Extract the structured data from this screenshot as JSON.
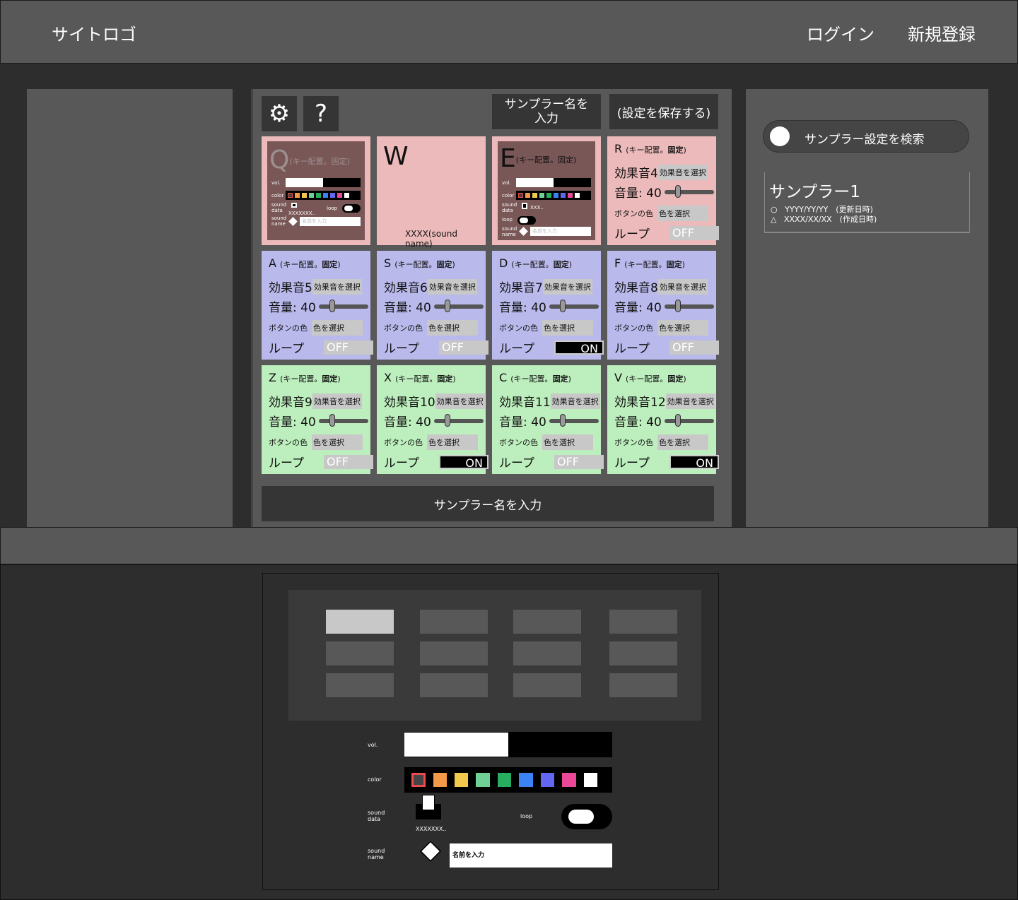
{
  "header": {
    "logo": "サイトロゴ",
    "login": "ログイン",
    "register": "新規登録"
  },
  "toolbar": {
    "settings_icon": "gear-icon",
    "help_label": "?",
    "name_input": "サンプラー名を\n入力",
    "save_label": "(設定を保存する)"
  },
  "pads_top": {
    "q": {
      "key": "Q",
      "note": "(キー配置。固定)",
      "vol": "vol.",
      "color": "color",
      "sound_data": "sound\ndata",
      "file": "XXXXXXX..",
      "loop": "loop",
      "sound_name": "sound\nname",
      "placeholder": "名前を入力"
    },
    "w": {
      "key": "W",
      "sound": "XXXX(sound name)"
    },
    "e": {
      "key": "E",
      "note": "(キー配置。固定)",
      "vol": "vol.",
      "color": "color",
      "sound_data": "sound\ndata",
      "file": "XXX..",
      "loop": "loop",
      "sound_name": "sound\nname",
      "placeholder": "名前を入力"
    }
  },
  "pads": [
    {
      "key": "R",
      "note": "(キー配置。",
      "bold": "固定",
      "close": ")",
      "sound": "効果音4",
      "choose": "効果音を選択",
      "volume": "音量: 40",
      "color_label": "ボタンの色",
      "color_choose": "色を選択",
      "loop_label": "ループ",
      "loop": "OFF",
      "on": false,
      "color": "pink",
      "volume_value": 40
    },
    {
      "key": "A",
      "note": "(キー配置。",
      "bold": "固定",
      "close": ")",
      "sound": "効果音5",
      "choose": "効果音を選択",
      "volume": "音量: 40",
      "color_label": "ボタンの色",
      "color_choose": "色を選択",
      "loop_label": "ループ",
      "loop": "OFF",
      "on": false,
      "color": "blue",
      "volume_value": 40
    },
    {
      "key": "S",
      "note": "(キー配置。",
      "bold": "固定",
      "close": ")",
      "sound": "効果音6",
      "choose": "効果音を選択",
      "volume": "音量: 40",
      "color_label": "ボタンの色",
      "color_choose": "色を選択",
      "loop_label": "ループ",
      "loop": "OFF",
      "on": false,
      "color": "blue",
      "volume_value": 40
    },
    {
      "key": "D",
      "note": "(キー配置。",
      "bold": "固定",
      "close": ")",
      "sound": "効果音7",
      "choose": "効果音を選択",
      "volume": "音量: 40",
      "color_label": "ボタンの色",
      "color_choose": "色を選択",
      "loop_label": "ループ",
      "loop": "ON",
      "on": true,
      "color": "blue",
      "volume_value": 40
    },
    {
      "key": "F",
      "note": "(キー配置。",
      "bold": "固定",
      "close": ")",
      "sound": "効果音8",
      "choose": "効果音を選択",
      "volume": "音量: 40",
      "color_label": "ボタンの色",
      "color_choose": "色を選択",
      "loop_label": "ループ",
      "loop": "OFF",
      "on": false,
      "color": "blue",
      "volume_value": 40
    },
    {
      "key": "Z",
      "note": "(キー配置。",
      "bold": "固定",
      "close": ")",
      "sound": "効果音9",
      "choose": "効果音を選択",
      "volume": "音量: 40",
      "color_label": "ボタンの色",
      "color_choose": "色を選択",
      "loop_label": "ループ",
      "loop": "OFF",
      "on": false,
      "color": "green",
      "volume_value": 40
    },
    {
      "key": "X",
      "note": "(キー配置。",
      "bold": "固定",
      "close": ")",
      "sound": "効果音10",
      "choose": "効果音を選択",
      "volume": "音量: 40",
      "color_label": "ボタンの色",
      "color_choose": "色を選択",
      "loop_label": "ループ",
      "loop": "ON",
      "on": true,
      "color": "green",
      "volume_value": 40
    },
    {
      "key": "C",
      "note": "(キー配置。",
      "bold": "固定",
      "close": ")",
      "sound": "効果音11",
      "choose": "効果音を選択",
      "volume": "音量: 40",
      "color_label": "ボタンの色",
      "color_choose": "色を選択",
      "loop_label": "ループ",
      "loop": "OFF",
      "on": false,
      "color": "green",
      "volume_value": 40
    },
    {
      "key": "V",
      "note": "(キー配置。",
      "bold": "固定",
      "close": ")",
      "sound": "効果音12",
      "choose": "効果音を選択",
      "volume": "音量: 40",
      "color_label": "ボタンの色",
      "color_choose": "色を選択",
      "loop_label": "ループ",
      "loop": "ON",
      "on": true,
      "color": "green",
      "volume_value": 40
    }
  ],
  "bottom_name": "サンプラー名を入力",
  "search": {
    "label": "サンプラー設定を検索"
  },
  "sampler": {
    "title": "サンプラー1",
    "updated": "YYYY/YY/YY　(更新日時)",
    "created": "XXXX/XX/XX　(作成日時)",
    "updated_mark": "○",
    "created_mark": "△"
  },
  "editor": {
    "vol": "vol.",
    "color": "color",
    "sound_data": "sound\ndata",
    "file": "XXXXXXX..",
    "loop": "loop",
    "sound_name": "sound\nname",
    "placeholder": "名前を入力",
    "volume_fraction": 0.5
  },
  "swatches": [
    "#ea4c4c",
    "#f39a4a",
    "#f2c94c",
    "#6fcf97",
    "#27ae60",
    "#3b82f6",
    "#6366f1",
    "#ec4899",
    "#ffffff"
  ]
}
